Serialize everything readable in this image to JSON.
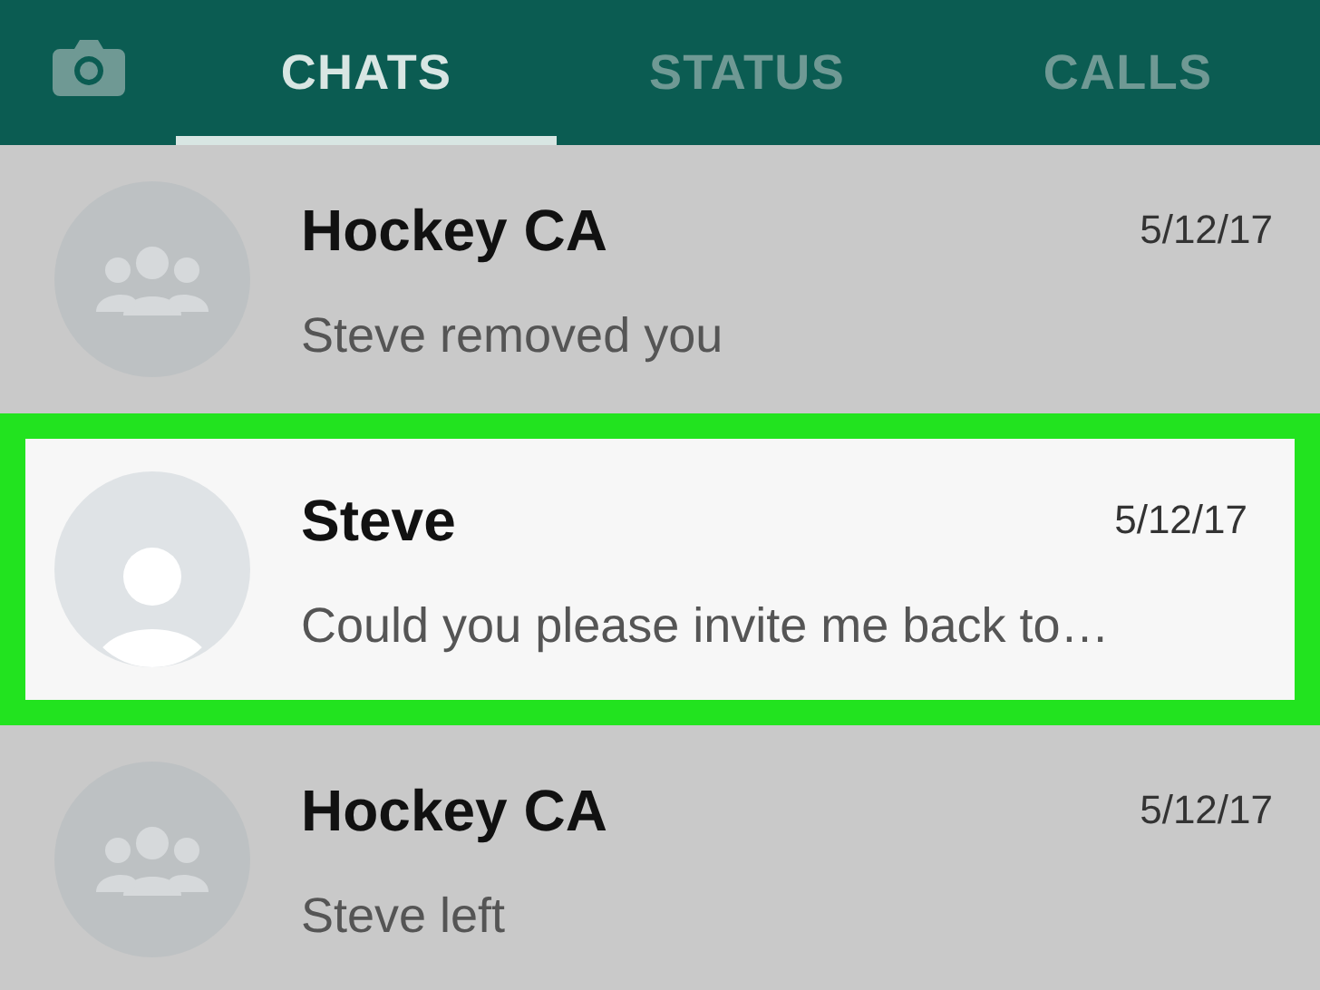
{
  "tabs": [
    {
      "label": "CHATS",
      "selected": true
    },
    {
      "label": "STATUS",
      "selected": false
    },
    {
      "label": "CALLS",
      "selected": false
    }
  ],
  "chats": [
    {
      "kind": "group",
      "name": "Hockey CA",
      "date": "5/12/17",
      "preview": "Steve removed you",
      "highlighted": false
    },
    {
      "kind": "person",
      "name": "Steve",
      "date": "5/12/17",
      "preview": "Could you please invite me back to…",
      "highlighted": true
    },
    {
      "kind": "group",
      "name": "Hockey CA",
      "date": "5/12/17",
      "preview": "Steve left",
      "highlighted": false
    }
  ]
}
